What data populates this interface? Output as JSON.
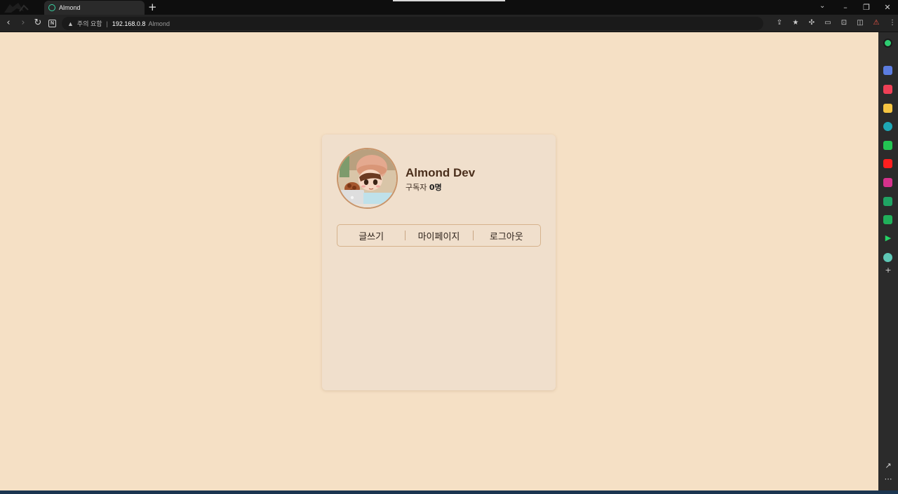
{
  "browser": {
    "tab_title": "Almond",
    "new_tab": "+",
    "warning_label": "주의 요함",
    "separator": "|",
    "url_host": "192.168.0.8",
    "url_page_title": "Almond",
    "reading_badge": "N",
    "accent_color": "#3ad6a5"
  },
  "window_controls": {
    "minimize": "–",
    "restore": "❐",
    "close": "✕"
  },
  "profile": {
    "name": "Almond Dev",
    "subscribers_label": "구독자",
    "subscribers_count": "0명"
  },
  "actions": {
    "write": "글쓰기",
    "mypage": "마이페이지",
    "logout": "로그아웃"
  },
  "colors": {
    "page_background": "#f5e0c5",
    "card_background": "#f0dfcc",
    "name_color": "#4b2f1c",
    "button_border": "#d6b28c"
  },
  "side_panel": {
    "icons": [
      "copilot-icon",
      "discord-icon",
      "pocket-icon",
      "star-icon",
      "edge-icon",
      "chat-icon",
      "youtube-icon",
      "instagram-icon",
      "sheets-icon",
      "mail-icon",
      "play-icon",
      "circle-icon",
      "add-icon"
    ],
    "open_external": "↗",
    "more": "⋯"
  }
}
